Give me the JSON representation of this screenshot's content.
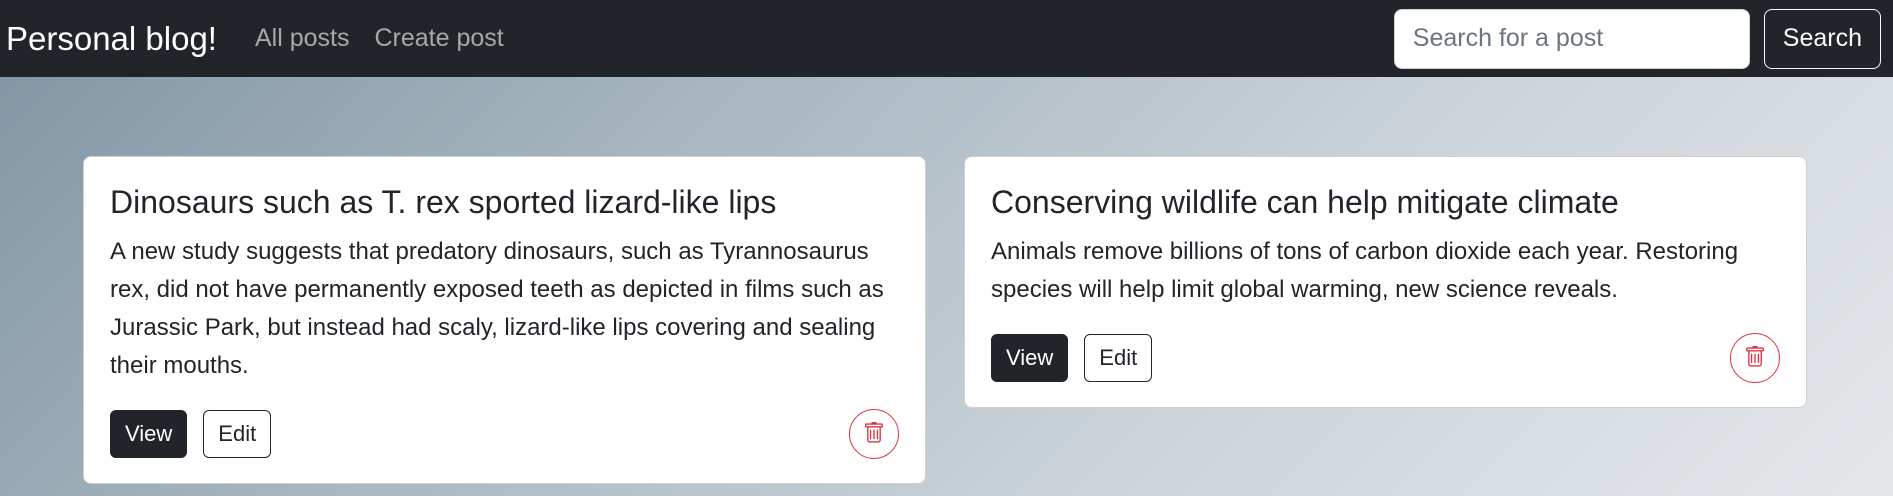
{
  "navbar": {
    "brand": "Personal blog!",
    "links": [
      "All posts",
      "Create post"
    ],
    "search": {
      "placeholder": "Search for a post",
      "value": "",
      "button_label": "Search"
    }
  },
  "posts": [
    {
      "title": "Dinosaurs such as T. rex sported lizard-like lips",
      "summary": "A new study suggests that predatory dinosaurs, such as Tyrannosaurus rex, did not have permanently exposed teeth as depicted in films such as Jurassic Park, but instead had scaly, lizard-like lips covering and sealing their mouths.",
      "view_label": "View",
      "edit_label": "Edit",
      "delete_icon": "trash-icon"
    },
    {
      "title": "Conserving wildlife can help mitigate climate",
      "summary": "Animals remove billions of tons of carbon dioxide each year. Restoring species will help limit global warming, new science reveals.",
      "view_label": "View",
      "edit_label": "Edit",
      "delete_icon": "trash-icon"
    }
  ],
  "colors": {
    "navbar_bg": "#212529",
    "danger": "#dc3545",
    "primary_dark": "#212529"
  }
}
